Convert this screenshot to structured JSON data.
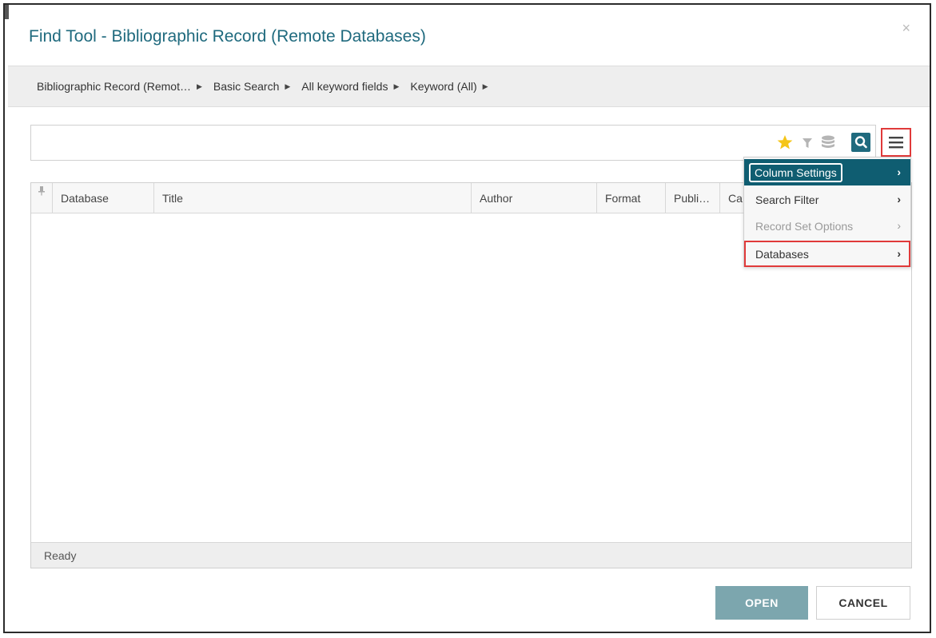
{
  "dialog": {
    "title": "Find Tool - Bibliographic Record (Remote Databases)",
    "close_glyph": "×"
  },
  "breadcrumb": [
    {
      "label": "Bibliographic Record (Remot…"
    },
    {
      "label": "Basic Search"
    },
    {
      "label": "All keyword fields"
    },
    {
      "label": "Keyword (All)"
    }
  ],
  "search": {
    "value": "",
    "placeholder": ""
  },
  "toolbar": {
    "icons": [
      "star-icon",
      "filter-icon",
      "database-icon",
      "search-icon",
      "hamburger-menu-icon"
    ],
    "accent_color": "#1f6a7e",
    "star_color": "#f5c518"
  },
  "grid": {
    "columns": [
      "Database",
      "Title",
      "Author",
      "Format",
      "Publi…",
      "Ca"
    ],
    "rows": [],
    "status": "Ready"
  },
  "menu": {
    "items": [
      {
        "label": "Column Settings",
        "state": "active"
      },
      {
        "label": "Search Filter",
        "state": "normal"
      },
      {
        "label": "Record Set Options",
        "state": "disabled"
      },
      {
        "label": "Databases",
        "state": "highlighted"
      }
    ],
    "chevron": "›"
  },
  "buttons": {
    "open": "OPEN",
    "cancel": "CANCEL"
  }
}
